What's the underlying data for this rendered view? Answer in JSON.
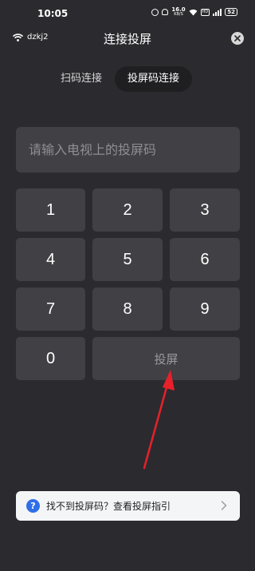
{
  "status_bar": {
    "time": "10:05",
    "speed_value": "16.0",
    "speed_unit": "KB/S",
    "network_badge": "HD",
    "battery": "52"
  },
  "header": {
    "wifi_name": "dzkj2",
    "title": "连接投屏",
    "close_icon": "close-icon"
  },
  "tabs": [
    {
      "label": "扫码连接",
      "active": false
    },
    {
      "label": "投屏码连接",
      "active": true
    }
  ],
  "code_input": {
    "placeholder": "请输入电视上的投屏码",
    "value": ""
  },
  "keypad": {
    "keys": [
      "1",
      "2",
      "3",
      "4",
      "5",
      "6",
      "7",
      "8",
      "9",
      "0"
    ],
    "cast_label": "投屏"
  },
  "help": {
    "icon": "question-icon",
    "text": "找不到投屏码？查看投屏指引"
  },
  "colors": {
    "background": "#2b2b2f",
    "key_bg": "#414145",
    "arrow": "#e8202a",
    "help_icon": "#2f6fe8"
  }
}
